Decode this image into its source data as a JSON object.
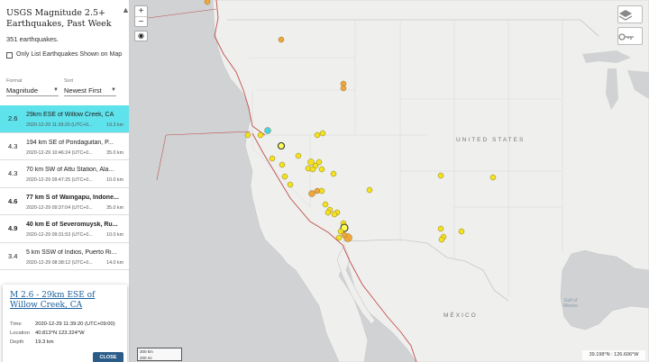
{
  "sidebar": {
    "title": "USGS Magnitude 2.5+ Earthquakes, Past Week",
    "collapse_icon": "▲▼",
    "count": "351 earthquakes.",
    "only_list_label": "Only List Earthquakes Shown on Map",
    "format_label": "Format",
    "format_value": "Magnitude",
    "sort_label": "Sort",
    "sort_value": "Newest First"
  },
  "earthquakes": [
    {
      "mag": "2.6",
      "place": "29km ESE of Willow Creek, CA",
      "time": "2020-12-29 11:39:20 (UTC+0...",
      "depth": "19.3 km",
      "bold": false,
      "active": true
    },
    {
      "mag": "4.3",
      "place": "194 km SE of Pondaguitan, P...",
      "time": "2020-12-29 10:46:24 (UTC+0...",
      "depth": "35.0 km",
      "bold": false,
      "active": false
    },
    {
      "mag": "4.3",
      "place": "70 km SW of Attu Station, Ala...",
      "time": "2020-12-29 09:47:25 (UTC+0...",
      "depth": "10.0 km",
      "bold": false,
      "active": false
    },
    {
      "mag": "4.6",
      "place": "77 km S of Waingapu, Indone...",
      "time": "2020-12-29 09:37:04 (UTC+0...",
      "depth": "35.0 km",
      "bold": true,
      "active": false
    },
    {
      "mag": "4.9",
      "place": "40 km E of Severomuysk, Ru...",
      "time": "2020-12-29 09:31:53 (UTC+0...",
      "depth": "10.0 km",
      "bold": true,
      "active": false
    },
    {
      "mag": "3.4",
      "place": "5 km SSW of Indios, Puerto Ri...",
      "time": "2020-12-29 08:38:12 (UTC+0...",
      "depth": "14.0 km",
      "bold": false,
      "active": false
    }
  ],
  "popup": {
    "title": "M 2.6 - 29km ESE of Willow Creek, CA",
    "time_label": "Time",
    "time_value": "2020-12-29 11:39:20 (UTC+09:00)",
    "location_label": "Location",
    "location_value": "40.813°N 123.324°W",
    "depth_label": "Depth",
    "depth_value": "19.3 km",
    "close_label": "CLOSE"
  },
  "map": {
    "zoom_in": "+",
    "zoom_out": "−",
    "locate_icon": "◉",
    "layers_icon": "layers-icon",
    "key_icon": "key-icon",
    "label_us": "UNITED STATES",
    "label_mexico": "MÉXICO",
    "label_gulf": "Gulf of Mexico",
    "scale_km": "300 km",
    "scale_mi": "200 mi",
    "coords": "39.198°N : 126.606°W",
    "colors": {
      "land": "#efefed",
      "water": "#d0d2d4",
      "plate_boundary": "#c0504d",
      "recent": "#45d3e6",
      "day": "#f4e21c",
      "hours": "#f0a63a",
      "week": "#ffff55"
    }
  }
}
